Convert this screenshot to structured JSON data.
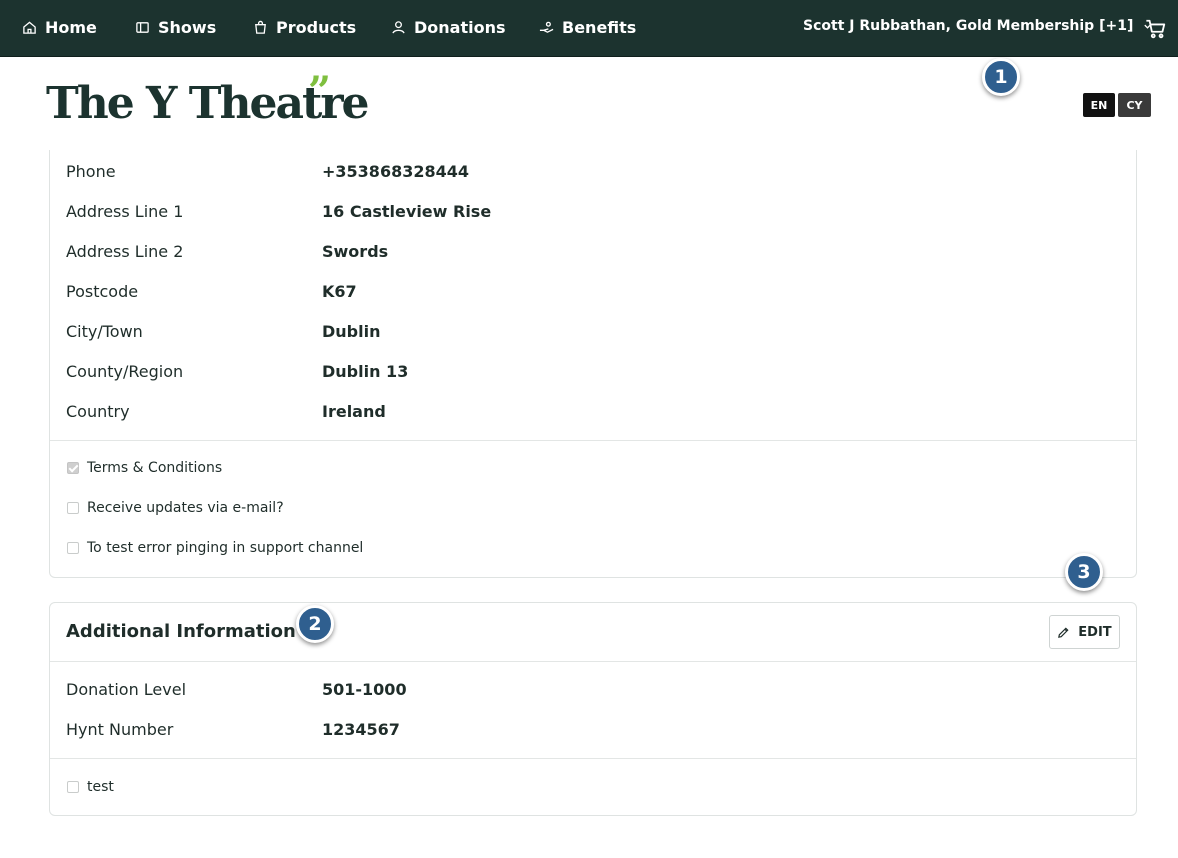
{
  "nav": {
    "items": [
      {
        "label": "Home",
        "icon": "home-icon"
      },
      {
        "label": "Shows",
        "icon": "ticket-icon"
      },
      {
        "label": "Products",
        "icon": "shopping-bag-icon"
      },
      {
        "label": "Donations",
        "icon": "donation-icon"
      },
      {
        "label": "Benefits",
        "icon": "benefit-hand-icon"
      }
    ],
    "user_label": "Scott J Rubbathan, Gold Membership [+1]",
    "cart_icon": "cart-icon"
  },
  "header": {
    "logo_text": "The Y Theatre",
    "logo_quote": "”",
    "languages": [
      "EN",
      "CY"
    ],
    "colors": {
      "bar": "#1c332f",
      "logo_accent": "#7fbf3f",
      "marker": "#2f5f8f"
    }
  },
  "markers": [
    "1",
    "2",
    "3"
  ],
  "contact": {
    "rows": [
      {
        "label": "Phone",
        "value": "+353868328444"
      },
      {
        "label": "Address Line 1",
        "value": "16 Castleview Rise"
      },
      {
        "label": "Address Line 2",
        "value": "Swords"
      },
      {
        "label": "Postcode",
        "value": "K67"
      },
      {
        "label": "City/Town",
        "value": "Dublin"
      },
      {
        "label": "County/Region",
        "value": "Dublin 13"
      },
      {
        "label": "Country",
        "value": "Ireland"
      }
    ],
    "checkboxes": [
      {
        "label": "Terms & Conditions",
        "checked": true
      },
      {
        "label": "Receive updates via e-mail?",
        "checked": false
      },
      {
        "label": "To test error pinging in support channel",
        "checked": false
      }
    ]
  },
  "additional": {
    "title": "Additional Information",
    "edit_label": "EDIT",
    "rows": [
      {
        "label": "Donation Level",
        "value": "501-1000"
      },
      {
        "label": "Hynt Number",
        "value": "1234567"
      }
    ],
    "checkboxes": [
      {
        "label": "test",
        "checked": false
      }
    ]
  }
}
